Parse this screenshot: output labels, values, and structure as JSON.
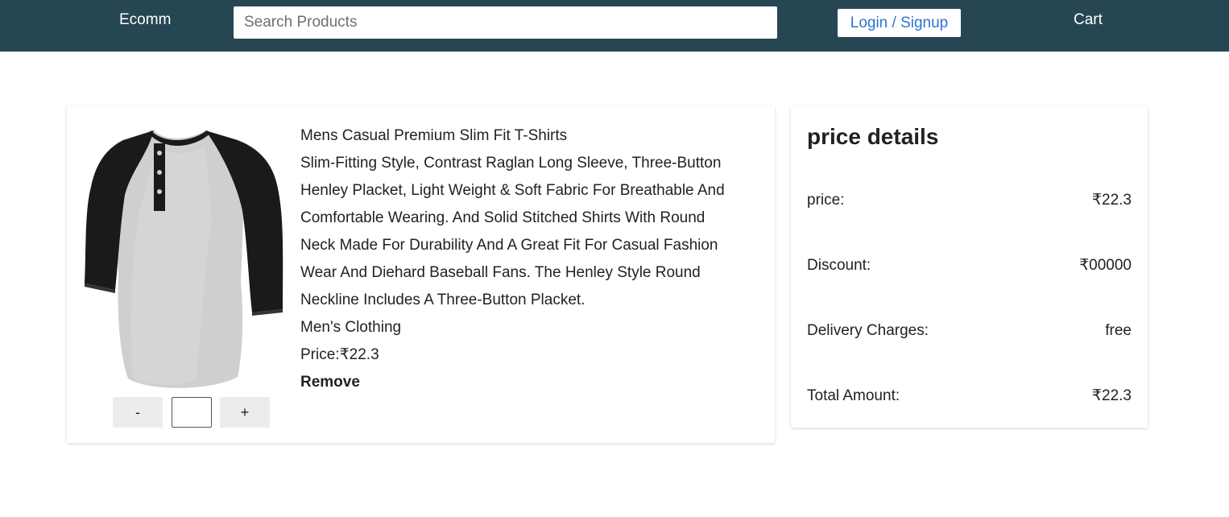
{
  "header": {
    "brand": "Ecomm",
    "search_placeholder": "Search Products",
    "login_label": "Login / Signup",
    "cart_label": "Cart"
  },
  "cart_item": {
    "title": "Mens Casual Premium Slim Fit T-Shirts",
    "description_lines": [
      "Slim-Fitting Style, Contrast Raglan Long Sleeve, Three-Button",
      "Henley Placket, Light Weight & Soft Fabric For Breathable And",
      "Comfortable Wearing. And Solid Stitched Shirts With Round",
      "Neck Made For Durability And A Great Fit For Casual Fashion",
      "Wear And Diehard Baseball Fans. The Henley Style Round",
      "Neckline Includes A Three-Button Placket."
    ],
    "category": "Men's Clothing",
    "price_text": "Price:₹22.3",
    "remove_label": "Remove",
    "quantity": {
      "minus_label": "-",
      "plus_label": "+",
      "value": ""
    }
  },
  "price_details": {
    "heading": "price details",
    "rows": [
      {
        "label": "price:",
        "value": "₹22.3"
      },
      {
        "label": "Discount:",
        "value": "₹00000"
      },
      {
        "label": "Delivery Charges:",
        "value": "free"
      },
      {
        "label": "Total Amount:",
        "value": "₹22.3"
      }
    ]
  },
  "colors": {
    "header_bg": "#264653",
    "link_blue": "#2f73d6"
  }
}
